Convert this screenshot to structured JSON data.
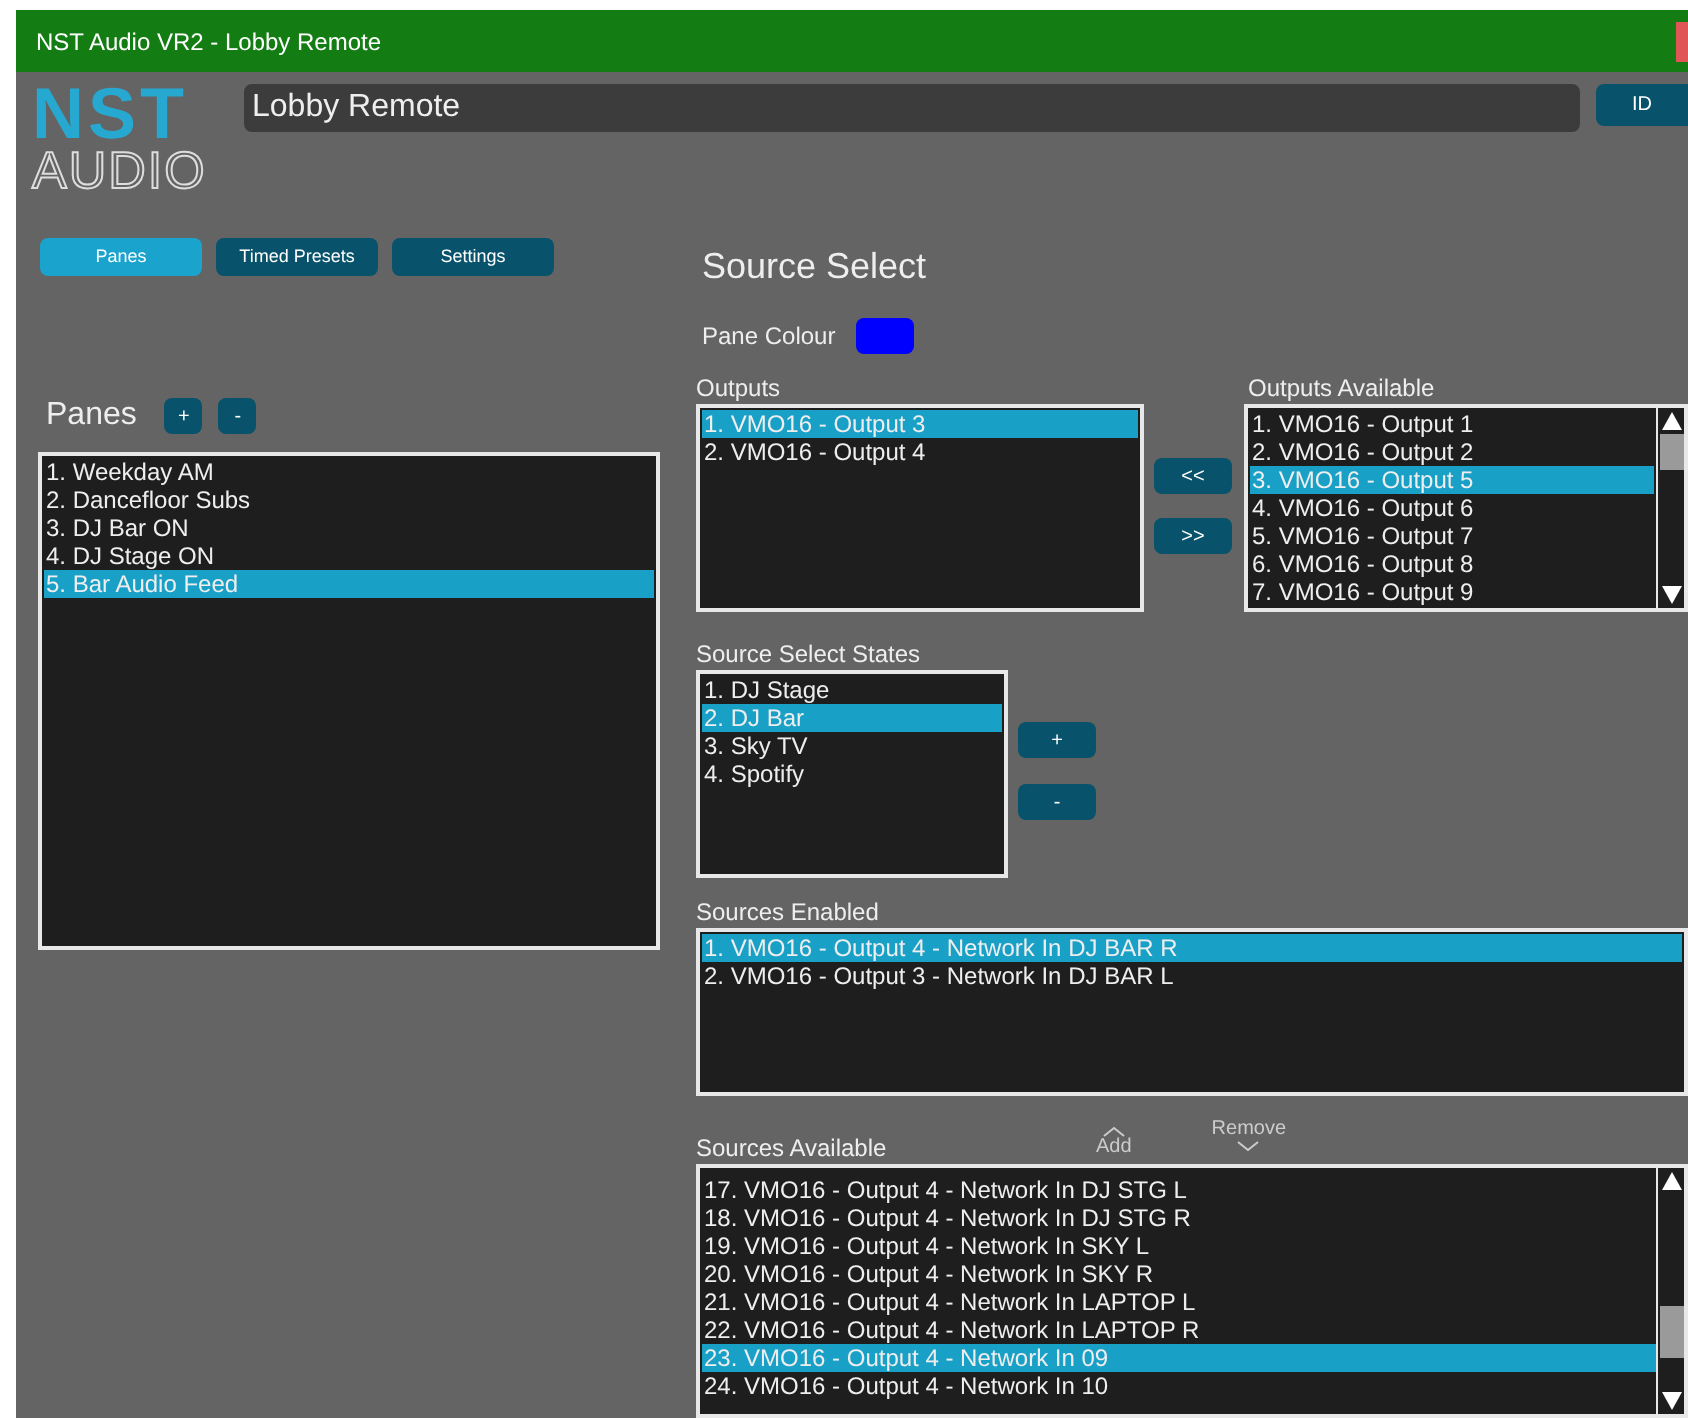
{
  "window": {
    "title": "NST Audio VR2 - Lobby Remote"
  },
  "logo": {
    "line_1": "NST",
    "line_2": "AUDIO"
  },
  "name_field": {
    "value": "Lobby Remote"
  },
  "id_button": "ID",
  "nav_tabs": [
    {
      "label": "Panes",
      "selected": true
    },
    {
      "label": "Timed Presets",
      "selected": false
    },
    {
      "label": "Settings",
      "selected": false
    }
  ],
  "panes": {
    "title": "Panes",
    "add_button": "+",
    "remove_button": "-",
    "items": [
      {
        "label": "1. Weekday AM",
        "selected": false
      },
      {
        "label": "2. Dancefloor Subs",
        "selected": false
      },
      {
        "label": "3. DJ Bar ON",
        "selected": false
      },
      {
        "label": "4. DJ Stage ON",
        "selected": false
      },
      {
        "label": "5. Bar Audio Feed",
        "selected": true
      }
    ]
  },
  "source_select": {
    "title": "Source Select",
    "pane_colour": {
      "label": "Pane Colour",
      "color": "#0000ff"
    },
    "outputs": {
      "label": "Outputs",
      "items": [
        {
          "label": "1. VMO16 - Output 3",
          "selected": true
        },
        {
          "label": "2. VMO16 - Output 4",
          "selected": false
        }
      ]
    },
    "move_left_button": "<<",
    "move_right_button": ">>",
    "outputs_available": {
      "label": "Outputs Available",
      "items": [
        {
          "label": "1. VMO16 - Output 1",
          "selected": false
        },
        {
          "label": "2. VMO16 - Output 2",
          "selected": false
        },
        {
          "label": "3. VMO16 - Output 5",
          "selected": true
        },
        {
          "label": "4. VMO16 - Output 6",
          "selected": false
        },
        {
          "label": "5. VMO16 - Output 7",
          "selected": false
        },
        {
          "label": "6. VMO16 - Output 8",
          "selected": false
        },
        {
          "label": "7. VMO16 - Output 9",
          "selected": false
        }
      ]
    },
    "states": {
      "label": "Source Select States",
      "add_button": "+",
      "remove_button": "-",
      "items": [
        {
          "label": "1. DJ Stage",
          "selected": false
        },
        {
          "label": "2. DJ Bar",
          "selected": true
        },
        {
          "label": "3. Sky TV",
          "selected": false
        },
        {
          "label": "4. Spotify",
          "selected": false
        }
      ]
    },
    "sources_enabled": {
      "label": "Sources Enabled",
      "items": [
        {
          "label": "1. VMO16 - Output 4 - Network In DJ BAR R",
          "selected": true
        },
        {
          "label": "2. VMO16 - Output 3 - Network In DJ BAR L",
          "selected": false
        }
      ]
    },
    "add_button": "Add",
    "remove_button": "Remove",
    "sources_available": {
      "label": "Sources Available",
      "items": [
        {
          "label": "17. VMO16 - Output 4 - Network In DJ STG L",
          "selected": false
        },
        {
          "label": "18. VMO16 - Output 4 - Network In DJ STG R",
          "selected": false
        },
        {
          "label": "19. VMO16 - Output 4 - Network In SKY L",
          "selected": false
        },
        {
          "label": "20. VMO16 - Output 4 - Network In SKY R",
          "selected": false
        },
        {
          "label": "21. VMO16 - Output 4 - Network In LAPTOP L",
          "selected": false
        },
        {
          "label": "22. VMO16 - Output 4 - Network In LAPTOP R",
          "selected": false
        },
        {
          "label": "23. VMO16 - Output 4 - Network In 09",
          "selected": true
        },
        {
          "label": "24. VMO16 - Output 4 - Network In 10",
          "selected": false
        }
      ]
    }
  }
}
